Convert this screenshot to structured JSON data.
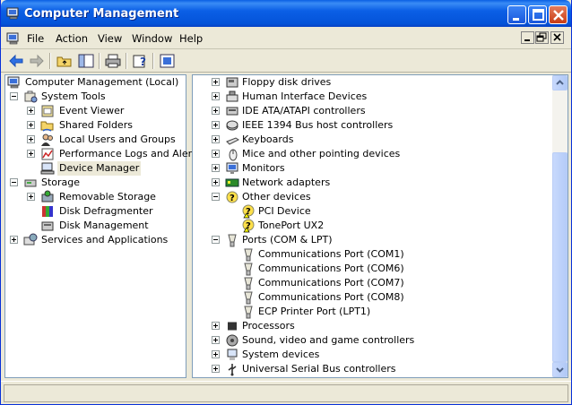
{
  "window": {
    "title": "Computer Management"
  },
  "menu": {
    "items": [
      "File",
      "Action",
      "View",
      "Window",
      "Help"
    ]
  },
  "toolbar": {
    "buttons": [
      "back-icon",
      "forward-icon",
      "up-folder-icon",
      "show-hide-tree-icon",
      "print-icon",
      "help-icon",
      "properties-icon"
    ]
  },
  "tree": {
    "root": "Computer Management (Local)",
    "system_tools": "System Tools",
    "event_viewer": "Event Viewer",
    "shared_folders": "Shared Folders",
    "local_users": "Local Users and Groups",
    "perf_logs": "Performance Logs and Alerts",
    "device_manager": "Device Manager",
    "storage": "Storage",
    "removable": "Removable Storage",
    "defrag": "Disk Defragmenter",
    "disk_mgmt": "Disk Management",
    "services": "Services and Applications"
  },
  "devices": [
    {
      "label": "Floppy disk drives",
      "level": 0,
      "exp": "plus",
      "icon": "floppy-drive-icon"
    },
    {
      "label": "Human Interface Devices",
      "level": 0,
      "exp": "plus",
      "icon": "hid-icon"
    },
    {
      "label": "IDE ATA/ATAPI controllers",
      "level": 0,
      "exp": "plus",
      "icon": "ide-controller-icon"
    },
    {
      "label": "IEEE 1394 Bus host controllers",
      "level": 0,
      "exp": "plus",
      "icon": "ieee1394-icon"
    },
    {
      "label": "Keyboards",
      "level": 0,
      "exp": "plus",
      "icon": "keyboard-icon"
    },
    {
      "label": "Mice and other pointing devices",
      "level": 0,
      "exp": "plus",
      "icon": "mouse-icon"
    },
    {
      "label": "Monitors",
      "level": 0,
      "exp": "plus",
      "icon": "monitor-icon"
    },
    {
      "label": "Network adapters",
      "level": 0,
      "exp": "plus",
      "icon": "network-adapter-icon"
    },
    {
      "label": "Other devices",
      "level": 0,
      "exp": "minus",
      "icon": "unknown-device-icon"
    },
    {
      "label": "PCI Device",
      "level": 1,
      "exp": "",
      "icon": "unknown-device-warning-icon"
    },
    {
      "label": "TonePort UX2",
      "level": 1,
      "exp": "",
      "icon": "unknown-device-warning-icon"
    },
    {
      "label": "Ports (COM & LPT)",
      "level": 0,
      "exp": "minus",
      "icon": "port-icon"
    },
    {
      "label": "Communications Port (COM1)",
      "level": 1,
      "exp": "",
      "icon": "port-icon"
    },
    {
      "label": "Communications Port (COM6)",
      "level": 1,
      "exp": "",
      "icon": "port-icon"
    },
    {
      "label": "Communications Port (COM7)",
      "level": 1,
      "exp": "",
      "icon": "port-icon"
    },
    {
      "label": "Communications Port (COM8)",
      "level": 1,
      "exp": "",
      "icon": "port-icon"
    },
    {
      "label": "ECP Printer Port (LPT1)",
      "level": 1,
      "exp": "",
      "icon": "port-icon"
    },
    {
      "label": "Processors",
      "level": 0,
      "exp": "plus",
      "icon": "processor-icon"
    },
    {
      "label": "Sound, video and game controllers",
      "level": 0,
      "exp": "plus",
      "icon": "sound-icon"
    },
    {
      "label": "System devices",
      "level": 0,
      "exp": "plus",
      "icon": "system-device-icon"
    },
    {
      "label": "Universal Serial Bus controllers",
      "level": 0,
      "exp": "plus",
      "icon": "usb-icon"
    }
  ],
  "colors": {
    "title_bar": "#0453d8",
    "selection": "#ece9d8",
    "pane_border": "#7f9db9"
  }
}
